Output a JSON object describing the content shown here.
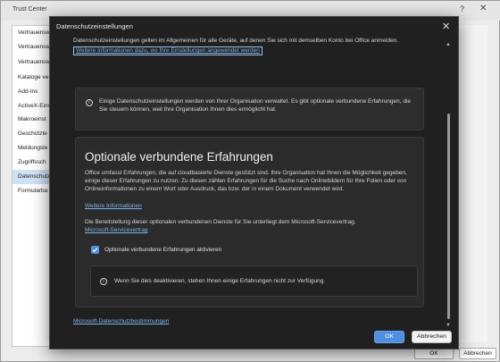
{
  "trust_center": {
    "title": "Trust Center",
    "help_glyph": "?",
    "close_glyph": "✕",
    "nav_items": [
      {
        "label": "Vertrauensw"
      },
      {
        "label": "Vertrauensw"
      },
      {
        "label": "Vertrauensw"
      },
      {
        "label": "Kataloge ve"
      },
      {
        "label": "Add-Ins"
      },
      {
        "label": "ActiveX-Eins"
      },
      {
        "label": "Makroeinst"
      },
      {
        "label": "Geschützte"
      },
      {
        "label": "Meldungsle"
      },
      {
        "label": "Zugriffssch"
      },
      {
        "label": "Datenschutz",
        "selected": true
      },
      {
        "label": "Formularba"
      }
    ],
    "ok_label": "OK",
    "cancel_label": "Abbrechen"
  },
  "dialog": {
    "title": "Datenschutzeinstellungen",
    "close_glyph": "✕",
    "intro_text": "Datenschutzeinstellungen gelten im Allgemeinen für alle Geräte, auf denen Sie sich mit demselben Konto bei Office anmelden.",
    "intro_link": "Weitere Informationen dazu, wo Ihre Einstellungen angewendet werden",
    "info_icon": "i",
    "org_info": "Einige Datenschutzeinstellungen werden von Ihrer Organisation verwaltet. Es gibt optionale verbundene Erfahrungen, die Sie steuern können, weil Ihre Organisation Ihnen dies ermöglicht hat.",
    "section": {
      "heading": "Optionale verbundene Erfahrungen",
      "description": "Office umfasst Erfahrungen, die auf cloudbasierte Dienste gestützt sind. Ihre Organisation hat Ihnen die Möglichkeit gegeben, einige dieser Erfahrungen zu nutzen. Zu diesen zählen Erfahrungen für die Suche nach Onlinebildern für Ihre Folien oder von Onlineinformationen zu einem Wort oder Ausdruck, das bzw. der in einem Dokument verwendet wird.",
      "more_info_link": "Weitere Informationen",
      "provision_text": "Die Bereitstellung dieser optionalen verbundenen Dienste für Sie unterliegt dem Microsoft-Servicevertrag.",
      "service_link": "Microsoft-Servicevertrag",
      "checkbox_label": "Optionale verbundene Erfahrungen aktivieren",
      "checkbox_checked": true,
      "warning_info": "Wenn Sie dies deaktivieren, stehen Ihnen einige Erfahrungen nicht zur Verfügung."
    },
    "privacy_link": "Microsoft-Datenschutzbestimmungen",
    "scroll_up": "▲",
    "scroll_down": "▼",
    "ok_label": "OK",
    "cancel_label": "Abbrechen",
    "accent_color": "#4f8fe0",
    "link_color": "#7fb3ea"
  }
}
